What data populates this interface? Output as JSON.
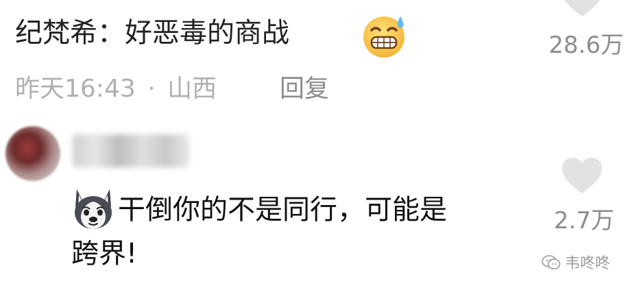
{
  "comment1": {
    "author_label": "纪梵希：",
    "text": "好恶毒的商战",
    "emoji": "grinning-sweat-emoji",
    "meta_time": "昨天16:43",
    "meta_dot": "·",
    "meta_location": "山西",
    "reply_label": "回复",
    "like_count": "28.6万"
  },
  "comment2": {
    "text_line1": "干倒你的不是同行，可能是",
    "text_line2": "跨界!",
    "emoji": "husky-dog-emoji",
    "like_count": "2.7万"
  },
  "watermark": {
    "text": "韦咚咚",
    "icon": "wechat-bubble-icon"
  },
  "colors": {
    "heart": "#e2e2e2",
    "meta_text": "#b0b0b0",
    "count_text": "#8c8c8c",
    "body_text": "#111111"
  }
}
